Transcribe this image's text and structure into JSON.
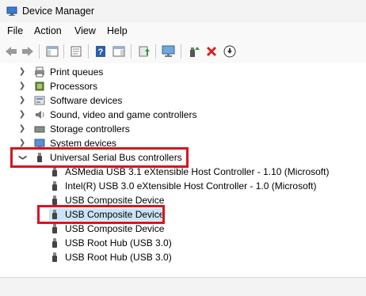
{
  "window": {
    "title": "Device Manager"
  },
  "menu": [
    "File",
    "Action",
    "View",
    "Help"
  ],
  "toolbar": {
    "buttons": [
      "back-icon",
      "forward-icon",
      "show-hide-console-tree-icon",
      "properties-icon",
      "help-icon",
      "action-pane-icon",
      "update-driver-icon",
      "scan-hardware-icon",
      "enable-device-icon",
      "uninstall-device-icon",
      "disable-device-icon"
    ]
  },
  "tree": {
    "categories_above": [
      {
        "label": "Print queues",
        "icon": "printer-icon"
      },
      {
        "label": "Processors",
        "icon": "processor-icon"
      },
      {
        "label": "Software devices",
        "icon": "software-icon"
      },
      {
        "label": "Sound, video and game controllers",
        "icon": "sound-icon"
      },
      {
        "label": "Storage controllers",
        "icon": "storage-icon"
      },
      {
        "label": "System devices",
        "icon": "system-icon"
      }
    ],
    "expanded_category": {
      "label": "Universal Serial Bus controllers",
      "icon": "usb-icon"
    },
    "usb_children": [
      "ASMedia USB 3.1 eXtensible Host Controller - 1.10 (Microsoft)",
      "Intel(R) USB 3.0 eXtensible Host Controller - 1.0 (Microsoft)",
      "USB Composite Device",
      "USB Composite Device",
      "USB Composite Device",
      "USB Root Hub (USB 3.0)",
      "USB Root Hub (USB 3.0)"
    ],
    "selected_child_index": 3
  },
  "colors": {
    "highlight_border": "#d8141f",
    "selection": "#cce4f7"
  }
}
